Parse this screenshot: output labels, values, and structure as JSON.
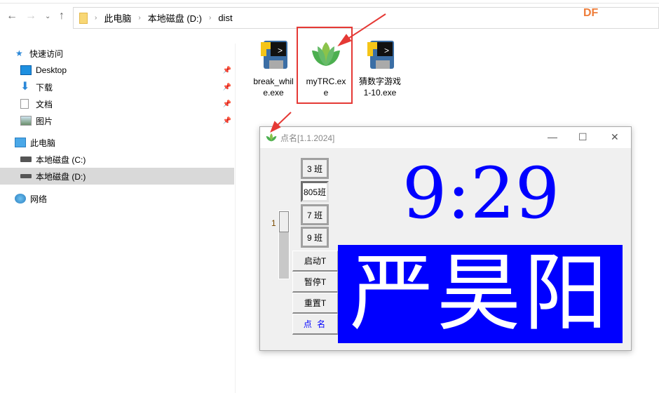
{
  "explorer": {
    "breadcrumb": [
      "此电脑",
      "本地磁盘 (D:)",
      "dist"
    ],
    "watermark": "DF",
    "sidebar": {
      "quick_access": "快速访问",
      "items": [
        {
          "label": "Desktop",
          "icon": "desktop-icon"
        },
        {
          "label": "下载",
          "icon": "download-icon"
        },
        {
          "label": "文档",
          "icon": "document-icon"
        },
        {
          "label": "图片",
          "icon": "pictures-icon"
        }
      ],
      "this_pc": "此电脑",
      "drives": [
        {
          "label": "本地磁盘 (C:)"
        },
        {
          "label": "本地磁盘 (D:)",
          "selected": true
        }
      ],
      "network": "网络"
    },
    "files": [
      {
        "name": "break_while.exe",
        "line1": "break_whil",
        "line2": "e.exe"
      },
      {
        "name": "myTRC.exe",
        "line1": "myTRC.ex",
        "line2": "e"
      },
      {
        "name": "猜数字游戏1-10.exe",
        "line1": "猜数字游戏",
        "line2": "1-10.exe"
      }
    ]
  },
  "app": {
    "title": "点名[1.1.2024]",
    "classes": [
      "3 班",
      "805班",
      "7 班",
      "9 班"
    ],
    "selected_class": "805班",
    "slider_value": "1",
    "actions": [
      "启动T",
      "暂停T",
      "重置T",
      "点 名"
    ],
    "clock": "9:29",
    "name": "严昊阳",
    "colors": {
      "accent": "#0000ff",
      "name_text": "#ffffff",
      "highlight": "#e53935"
    }
  }
}
